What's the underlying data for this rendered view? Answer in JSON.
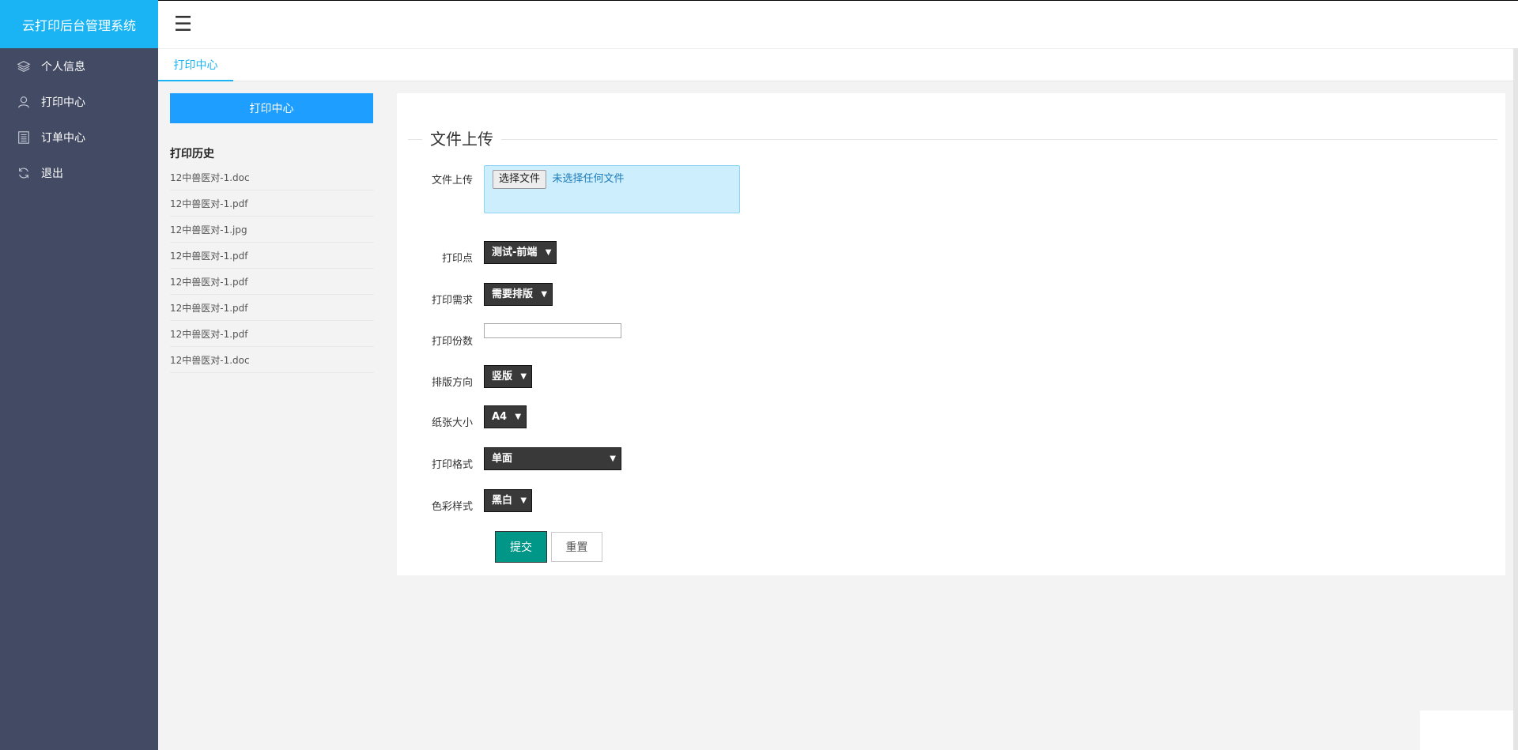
{
  "app": {
    "title": "云打印后台管理系统"
  },
  "topbar": {
    "menu_icon": "hamburger-menu-icon",
    "menu_glyph": "☰"
  },
  "sidebar": {
    "items": [
      {
        "label": "个人信息",
        "icon": "layers-icon"
      },
      {
        "label": "打印中心",
        "icon": "user-icon"
      },
      {
        "label": "订单中心",
        "icon": "list-document-icon"
      },
      {
        "label": "退出",
        "icon": "refresh-icon"
      }
    ]
  },
  "tabs": [
    {
      "label": "打印中心",
      "active": true
    }
  ],
  "history": {
    "button_label": "打印中心",
    "title": "打印历史",
    "files": [
      "12中兽医对-1.doc",
      "12中兽医对-1.pdf",
      "12中兽医对-1.jpg",
      "12中兽医对-1.pdf",
      "12中兽医对-1.pdf",
      "12中兽医对-1.pdf",
      "12中兽医对-1.pdf",
      "12中兽医对-1.doc"
    ]
  },
  "form": {
    "legend": "文件上传",
    "upload": {
      "label": "文件上传",
      "button": "选择文件",
      "status": "未选择任何文件"
    },
    "print_point": {
      "label": "打印点",
      "value": "测试-前端"
    },
    "requirement": {
      "label": "打印需求",
      "value": "需要排版"
    },
    "copies": {
      "label": "打印份数",
      "value": ""
    },
    "orientation": {
      "label": "排版方向",
      "value": "竖版"
    },
    "paper_size": {
      "label": "纸张大小",
      "value": "A4"
    },
    "print_format": {
      "label": "打印格式",
      "value": "单面"
    },
    "color_mode": {
      "label": "色彩样式",
      "value": "黑白"
    },
    "submit_label": "提交",
    "reset_label": "重置"
  },
  "colors": {
    "brand": "#1ab4f5",
    "sidebar": "#434a64",
    "primary_button": "#1e9fff",
    "submit": "#009688"
  }
}
